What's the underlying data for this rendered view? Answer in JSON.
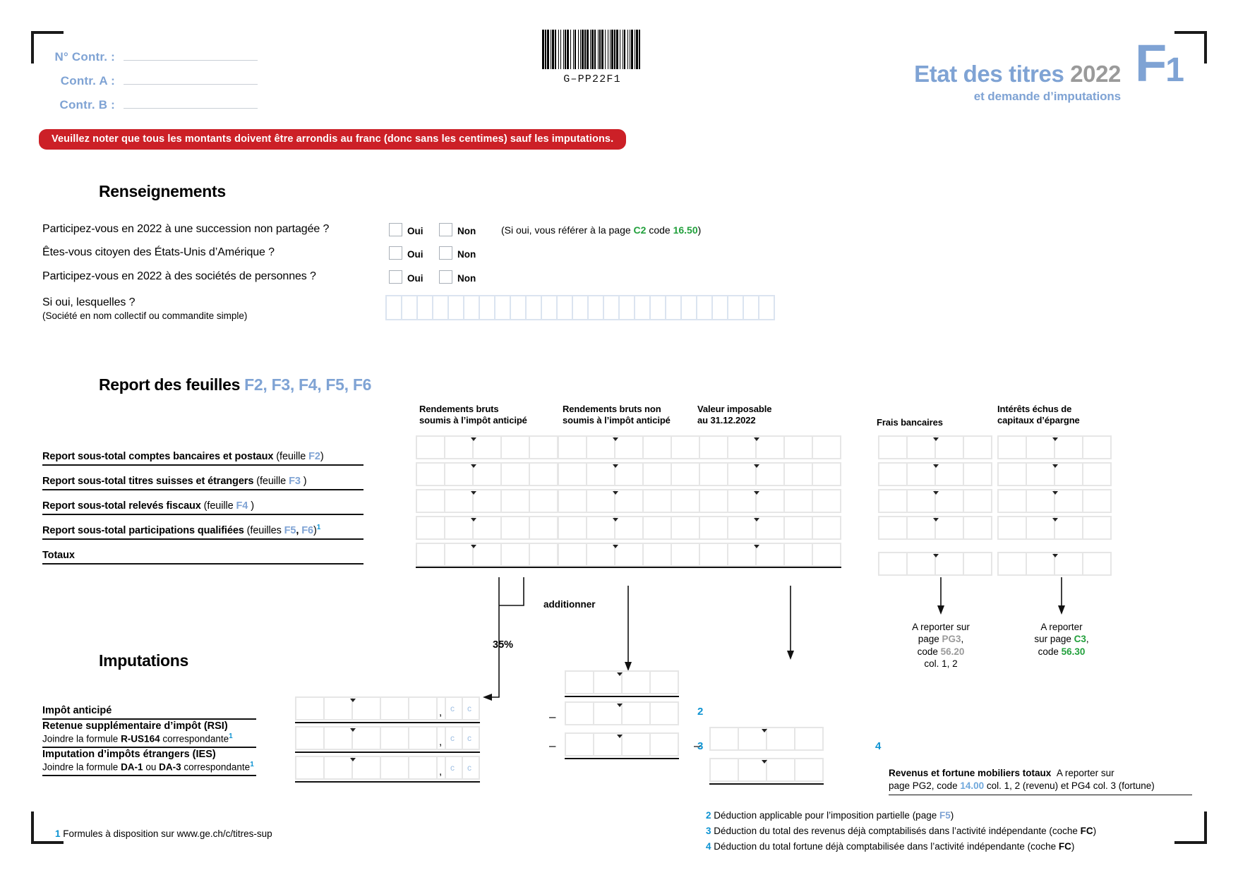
{
  "header": {
    "contr_fields": [
      {
        "label": "N° Contr. :",
        "value": ""
      },
      {
        "label": "Contr. A :",
        "value": ""
      },
      {
        "label": "Contr. B :",
        "value": ""
      }
    ],
    "barcode_text": "G–PP22F1",
    "title_main": "Etat des titres",
    "title_year": "2022",
    "title_sub": "et demande d’imputations",
    "logo_letter": "F",
    "logo_number": "1",
    "banner": "Veuillez noter que tous les montants doivent être arrondis au franc (donc sans les centimes) sauf les imputations."
  },
  "renseignements": {
    "heading": "Renseignements",
    "yes_label": "Oui",
    "no_label": "Non",
    "questions": [
      {
        "text": "Participez-vous en 2022 à une succession non partagée ?",
        "hint_pre": "(Si oui, vous référer à la page ",
        "hint_page": "C2",
        "hint_mid": " code ",
        "hint_code": "16.50",
        "hint_post": ")"
      },
      {
        "text": "Êtes-vous citoyen des États-Unis d’Amérique ?"
      },
      {
        "text": "Participez-vous en 2022 à des sociétés de personnes ?"
      }
    ],
    "which_label": "Si oui, lesquelles ?",
    "which_sub": "(Société en nom collectif ou commandite simple)",
    "which_cell_count": 25
  },
  "report": {
    "heading_pre": "Report des feuilles ",
    "heading_sheets": [
      "F2",
      "F3",
      "F4",
      "F5",
      "F6"
    ],
    "columns": [
      {
        "line1": "Rendements bruts",
        "line2": "soumis à l’impôt anticipé"
      },
      {
        "line1": "Rendements bruts non",
        "line2": "soumis à l’impôt anticipé"
      },
      {
        "line1": "Valeur imposable",
        "line2": "au 31.12.2022"
      },
      {
        "line1": "Frais bancaires",
        "line2": ""
      },
      {
        "line1": "Intérêts échus de",
        "line2": "capitaux d’épargne"
      }
    ],
    "rows": [
      {
        "label_bold": "Report sous-total comptes bancaires et postaux",
        "label_rest": " (feuille ",
        "sheets": [
          "F2"
        ],
        "label_end": ")",
        "footnote": ""
      },
      {
        "label_bold": "Report sous-total titres suisses et étrangers",
        "label_rest": " (feuille ",
        "sheets": [
          "F3"
        ],
        "label_end": " )",
        "footnote": ""
      },
      {
        "label_bold": "Report sous-total relevés fiscaux",
        "label_rest": " (feuille ",
        "sheets": [
          "F4"
        ],
        "label_end": " )",
        "footnote": ""
      },
      {
        "label_bold": "Report sous-total participations qualifiées",
        "label_rest": " (feuilles ",
        "sheets": [
          "F5",
          "F6"
        ],
        "label_end": ")",
        "footnote": "1"
      },
      {
        "label_bold": "Totaux",
        "label_rest": "",
        "sheets": [],
        "label_end": "",
        "footnote": ""
      }
    ],
    "additionner_label": "additionner",
    "pct_label": "35%",
    "bank_fee_note": [
      "A reporter sur",
      "page ",
      "PG3",
      ",",
      "code ",
      "56.20",
      "col. 1, 2"
    ],
    "bank_fee_note_lines": [
      {
        "text": "A reporter sur"
      },
      {
        "pre": "page ",
        "code": "PG3",
        "post": ","
      },
      {
        "pre": "code ",
        "code": "56.20",
        "post": ""
      },
      {
        "text": "col. 1, 2"
      }
    ],
    "interest_note_lines": [
      {
        "text": "A reporter"
      },
      {
        "pre": "sur page ",
        "code": "C3",
        "post": ","
      },
      {
        "pre": "code ",
        "code": "56.30",
        "post": ""
      }
    ]
  },
  "imputations": {
    "heading": "Imputations",
    "rows": [
      {
        "line1_bold": "Impôt anticipé",
        "line2_pre": "",
        "line2_bold": "",
        "line2_post": "",
        "footnote": ""
      },
      {
        "line1_bold": "Retenue supplémentaire d’impôt (RSI)",
        "line2_pre": "Joindre la formule ",
        "line2_bold": "R-US164",
        "line2_post": " correspondante",
        "footnote": "1"
      },
      {
        "line1_bold": "Imputation d’impôts étrangers (IES)",
        "line2_pre": "Joindre la formule ",
        "line2_bold": "DA-1",
        "line2_mid": " ou ",
        "line2_bold2": "DA-3",
        "line2_post": " correspondante",
        "footnote": "1"
      }
    ],
    "cents_label": "c",
    "minus": "–",
    "markers": [
      "2",
      "3",
      "4"
    ],
    "totals_bold": "Revenus et fortune mobiliers totaux",
    "totals_lead": "A reporter sur",
    "totals_line2_pre": "page PG2, code ",
    "totals_line2_code": "14.00",
    "totals_line2_post": " col. 1, 2 (revenu) et PG4 col. 3 (fortune)"
  },
  "footnotes": [
    {
      "num": "1",
      "text": "Formules à disposition sur www.ge.ch/c/titres-sup"
    },
    {
      "num": "2",
      "pre": "Déduction applicable pour l’imposition partielle (page ",
      "ref": "F5",
      "post": ")"
    },
    {
      "num": "3",
      "pre": "Déduction du total des revenus déjà comptabilisés dans l’activité indépendante (coche ",
      "ref_bold": "FC",
      "post": ")"
    },
    {
      "num": "4",
      "pre": "Déduction du total fortune déjà comptabilisée dans l’activité indépendante (coche ",
      "ref_bold": "FC",
      "post": ")"
    }
  ],
  "colors": {
    "accent_blue": "#7fa3d4",
    "banner_red": "#cc2027",
    "green": "#22a03c",
    "cyan": "#0d93d2",
    "grey": "#9a9a9a"
  }
}
